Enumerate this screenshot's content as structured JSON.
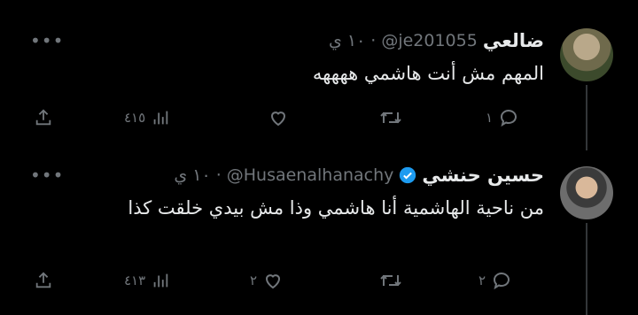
{
  "tweets": [
    {
      "name": "ضالعي",
      "handle": "@je201055",
      "time": "١٠ ي",
      "text": "المهم مش أنت هاشمي ههههه",
      "replies": "١",
      "retweets": "",
      "likes": "",
      "views": "٤١٥",
      "verified": false,
      "avatar_icon": "profile-photo-soldier"
    },
    {
      "name": "حسين حنشي",
      "handle": "@Husaenalhanachy",
      "time": "١٠ ي",
      "text": "من ناحية الهاشمية أنا هاشمي وذا مش بيدي خلقت كذا",
      "replies": "٢",
      "retweets": "",
      "likes": "٢",
      "views": "٤١٣",
      "verified": true,
      "avatar_icon": "profile-photo-man"
    }
  ],
  "colors": {
    "background": "#000000",
    "text": "#e7e9ea",
    "muted": "#71767b",
    "verified": "#1d9bf0"
  }
}
